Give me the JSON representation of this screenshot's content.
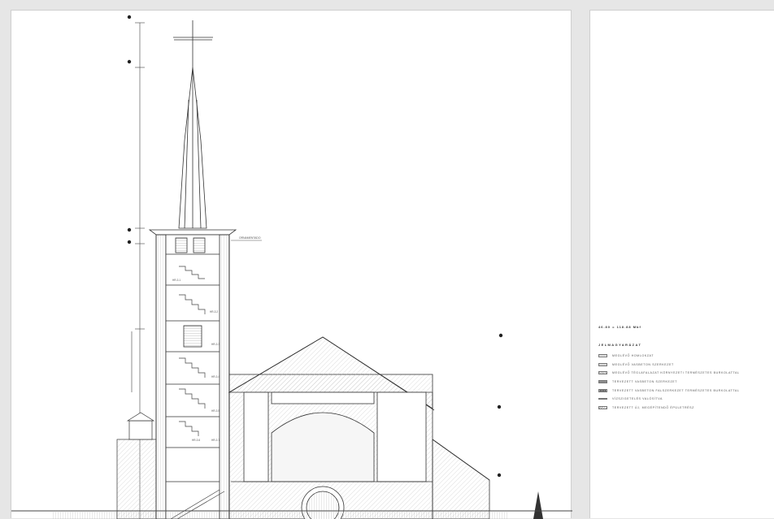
{
  "drawing": {
    "annotations": {
      "spire_note": "ORNAMENTADO",
      "room_labels": [
        "HR-3.1",
        "HR-3.2",
        "HR-3.3",
        "HR-3.4",
        "HR-3.5",
        "HR-3.6",
        "HR-3.7"
      ]
    }
  },
  "legend": {
    "scale": "46.80 = 118.88 Mbf",
    "title": "JELMAGYARÁZAT",
    "items": [
      "MEGLÉVŐ HOMLOKZAT",
      "MEGLÉVŐ VASBETON SZERKEZET",
      "MEGLÉVŐ TÉGLAFALAZAT KÖRNYEZETI TERMÉSZETES BURKOLATTAL",
      "TERVEZETT VASBETON SZERKEZET",
      "TERVEZETT VASBETON FALSZERKEZET TERMÉSZETES BURKOLATTAL",
      "VÍZSZIGETELÉS VALÓSÍTVA",
      "TERVEZETT ÚJ, MEGÉPÍTENDŐ ÉPÜLETRÉSZ"
    ],
    "swatch_colors": [
      "#d9d9d9",
      "#cfcfcf",
      "#b5b5b5",
      "#8d8d8d",
      "#6f6f6f",
      "#666666",
      "#bfbfbf"
    ]
  }
}
